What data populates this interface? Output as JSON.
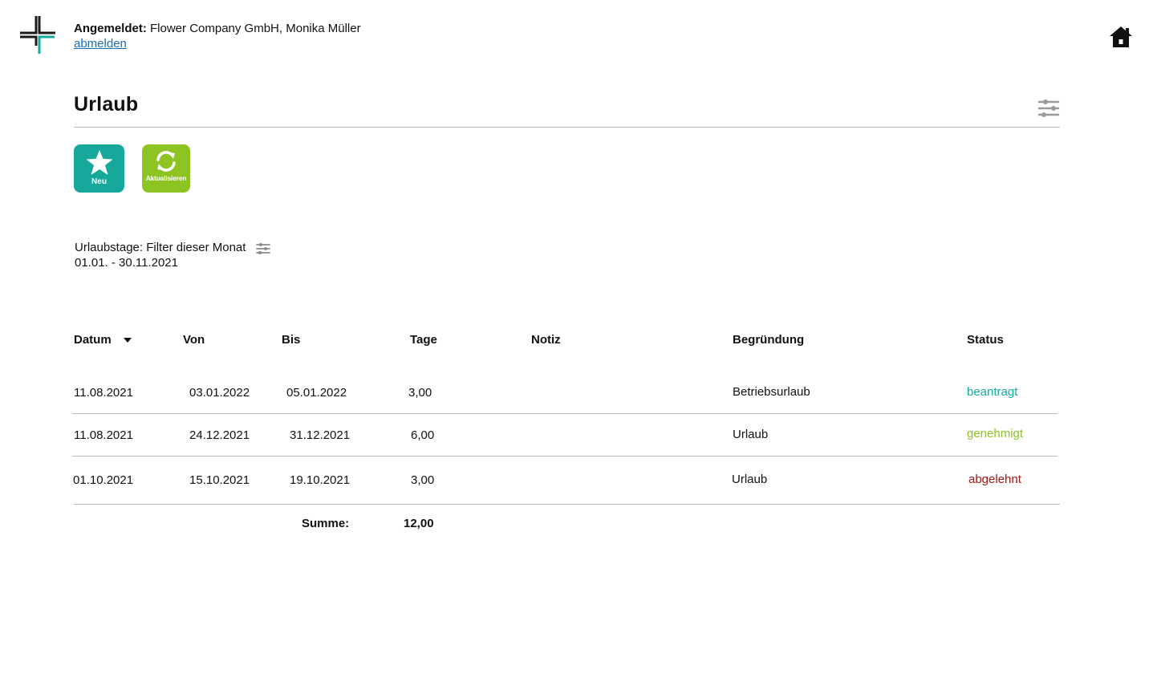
{
  "header": {
    "login_label": "Angemeldet:",
    "login_user": "Flower Company GmbH, Monika Müller",
    "logout_link": "abmelden"
  },
  "page": {
    "title": "Urlaub"
  },
  "actions": {
    "new_label": "Neu",
    "refresh_label": "Aktualisieren"
  },
  "filter": {
    "label": "Urlaubstage:",
    "value": "Filter dieser Monat",
    "range": "01.01. - 30.11.2021"
  },
  "table": {
    "columns": {
      "datum": "Datum",
      "von": "Von",
      "bis": "Bis",
      "tage": "Tage",
      "notiz": "Notiz",
      "begruendung": "Begründung",
      "status": "Status"
    },
    "rows": [
      {
        "datum": "11.08.2021",
        "von": "03.01.2022",
        "bis": "05.01.2022",
        "tage": "3,00",
        "notiz": "",
        "begruendung": "Betriebsurlaub",
        "status": "beantragt"
      },
      {
        "datum": "11.08.2021",
        "von": "24.12.2021",
        "bis": "31.12.2021",
        "tage": "6,00",
        "notiz": "",
        "begruendung": "Urlaub",
        "status": "genehmigt"
      },
      {
        "datum": "01.10.2021",
        "von": "15.10.2021",
        "bis": "19.10.2021",
        "tage": "3,00",
        "notiz": "",
        "begruendung": "Urlaub",
        "status": "abgelehnt"
      }
    ],
    "sum_label": "Summe:",
    "sum_value": "12,00"
  },
  "colors": {
    "brand_teal": "#16a89b",
    "brand_green": "#8ec324",
    "status_rejected": "#a01515",
    "link": "#1a6fb5"
  },
  "icons": {
    "logo": "logo-mark",
    "home": "home-icon",
    "settings": "settings-sliders-icon",
    "filter": "filter-sliders-icon",
    "new": "star-icon",
    "refresh": "refresh-icon",
    "sort": "sort-down-icon"
  }
}
